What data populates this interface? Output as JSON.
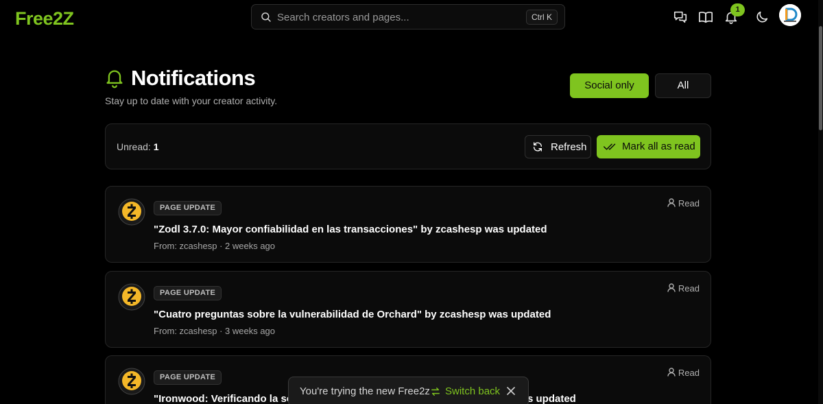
{
  "header": {
    "logo": "Free2Z",
    "search_placeholder": "Search creators and pages...",
    "search_shortcut": "Ctrl K",
    "notification_count": "1",
    "icons": [
      "chat-icon",
      "book-icon",
      "bell-icon",
      "moon-icon"
    ]
  },
  "page": {
    "title": "Notifications",
    "subtitle": "Stay up to date with your creator activity.",
    "filter_social": "Social only",
    "filter_all": "All"
  },
  "toolbar": {
    "unread_label": "Unread:",
    "unread_count": "1",
    "refresh_label": "Refresh",
    "mark_all_label": "Mark all as read"
  },
  "notifications": [
    {
      "badge": "PAGE UPDATE",
      "title": "\"Zodl 3.7.0: Mayor confiabilidad en las transacciones\" by zcashesp was updated",
      "meta": "From: zcashesp · 2 weeks ago",
      "status": "Read"
    },
    {
      "badge": "PAGE UPDATE",
      "title": "\"Cuatro preguntas sobre la vulnerabilidad de Orchard\" by zcashesp was updated",
      "meta": "From: zcashesp · 3 weeks ago",
      "status": "Read"
    },
    {
      "badge": "PAGE UPDATE",
      "title": "\"Ironwood: Verificando la solic",
      "title_tail": "s updated",
      "meta": "",
      "status": "Read"
    }
  ],
  "toast": {
    "message": "You're trying the new Free2z",
    "action": "Switch back"
  },
  "colors": {
    "accent": "#7fc41f",
    "background": "#000000",
    "card": "#0b0b0b",
    "zcash": "#f4b728"
  }
}
